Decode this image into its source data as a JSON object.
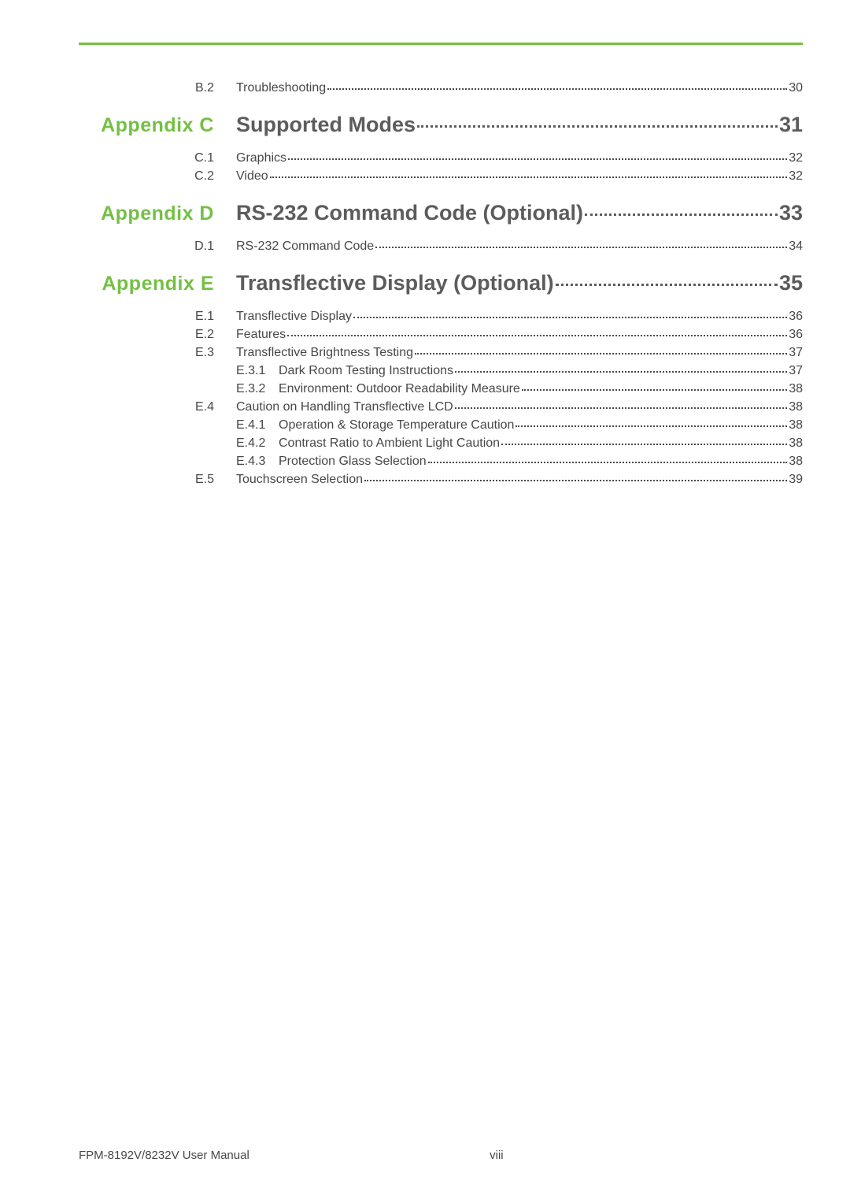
{
  "entries": [
    {
      "kind": "sub",
      "label": "B.2",
      "title": "Troubleshooting",
      "page": "30",
      "indent": 0
    },
    {
      "kind": "heading",
      "label": "Appendix C",
      "title": "Supported Modes",
      "page": "31"
    },
    {
      "kind": "sub",
      "label": "C.1",
      "title": "Graphics",
      "page": "32",
      "indent": 0
    },
    {
      "kind": "sub",
      "label": "C.2",
      "title": "Video",
      "page": "32",
      "indent": 0
    },
    {
      "kind": "heading",
      "label": "Appendix D",
      "title": "RS-232 Command Code (Optional)",
      "page": "33"
    },
    {
      "kind": "sub",
      "label": "D.1",
      "title": "RS-232 Command Code",
      "page": "34",
      "indent": 0
    },
    {
      "kind": "heading",
      "label": "Appendix E",
      "title": "Transflective Display (Optional)",
      "page": "35"
    },
    {
      "kind": "sub",
      "label": "E.1",
      "title": "Transflective Display",
      "page": "36",
      "indent": 0
    },
    {
      "kind": "sub",
      "label": "E.2",
      "title": "Features",
      "page": "36",
      "indent": 0
    },
    {
      "kind": "sub",
      "label": "E.3",
      "title": "Transflective Brightness Testing",
      "page": "37",
      "indent": 0
    },
    {
      "kind": "sub",
      "label": "",
      "subnum": "E.3.1",
      "title": "Dark Room Testing Instructions",
      "page": "37",
      "indent": 1
    },
    {
      "kind": "sub",
      "label": "",
      "subnum": "E.3.2",
      "title": "Environment: Outdoor Readability Measure",
      "page": "38",
      "indent": 1
    },
    {
      "kind": "sub",
      "label": "E.4",
      "title": "Caution on Handling Transflective LCD",
      "page": "38",
      "indent": 0
    },
    {
      "kind": "sub",
      "label": "",
      "subnum": "E.4.1",
      "title": "Operation & Storage Temperature Caution",
      "page": "38",
      "indent": 1
    },
    {
      "kind": "sub",
      "label": "",
      "subnum": "E.4.2",
      "title": "Contrast Ratio to Ambient Light Caution",
      "page": "38",
      "indent": 1
    },
    {
      "kind": "sub",
      "label": "",
      "subnum": "E.4.3",
      "title": "Protection Glass Selection",
      "page": "38",
      "indent": 1
    },
    {
      "kind": "sub",
      "label": "E.5",
      "title": "Touchscreen Selection",
      "page": "39",
      "indent": 0
    }
  ],
  "footer": {
    "manual": "FPM-8192V/8232V User Manual",
    "pagenum": "viii"
  }
}
